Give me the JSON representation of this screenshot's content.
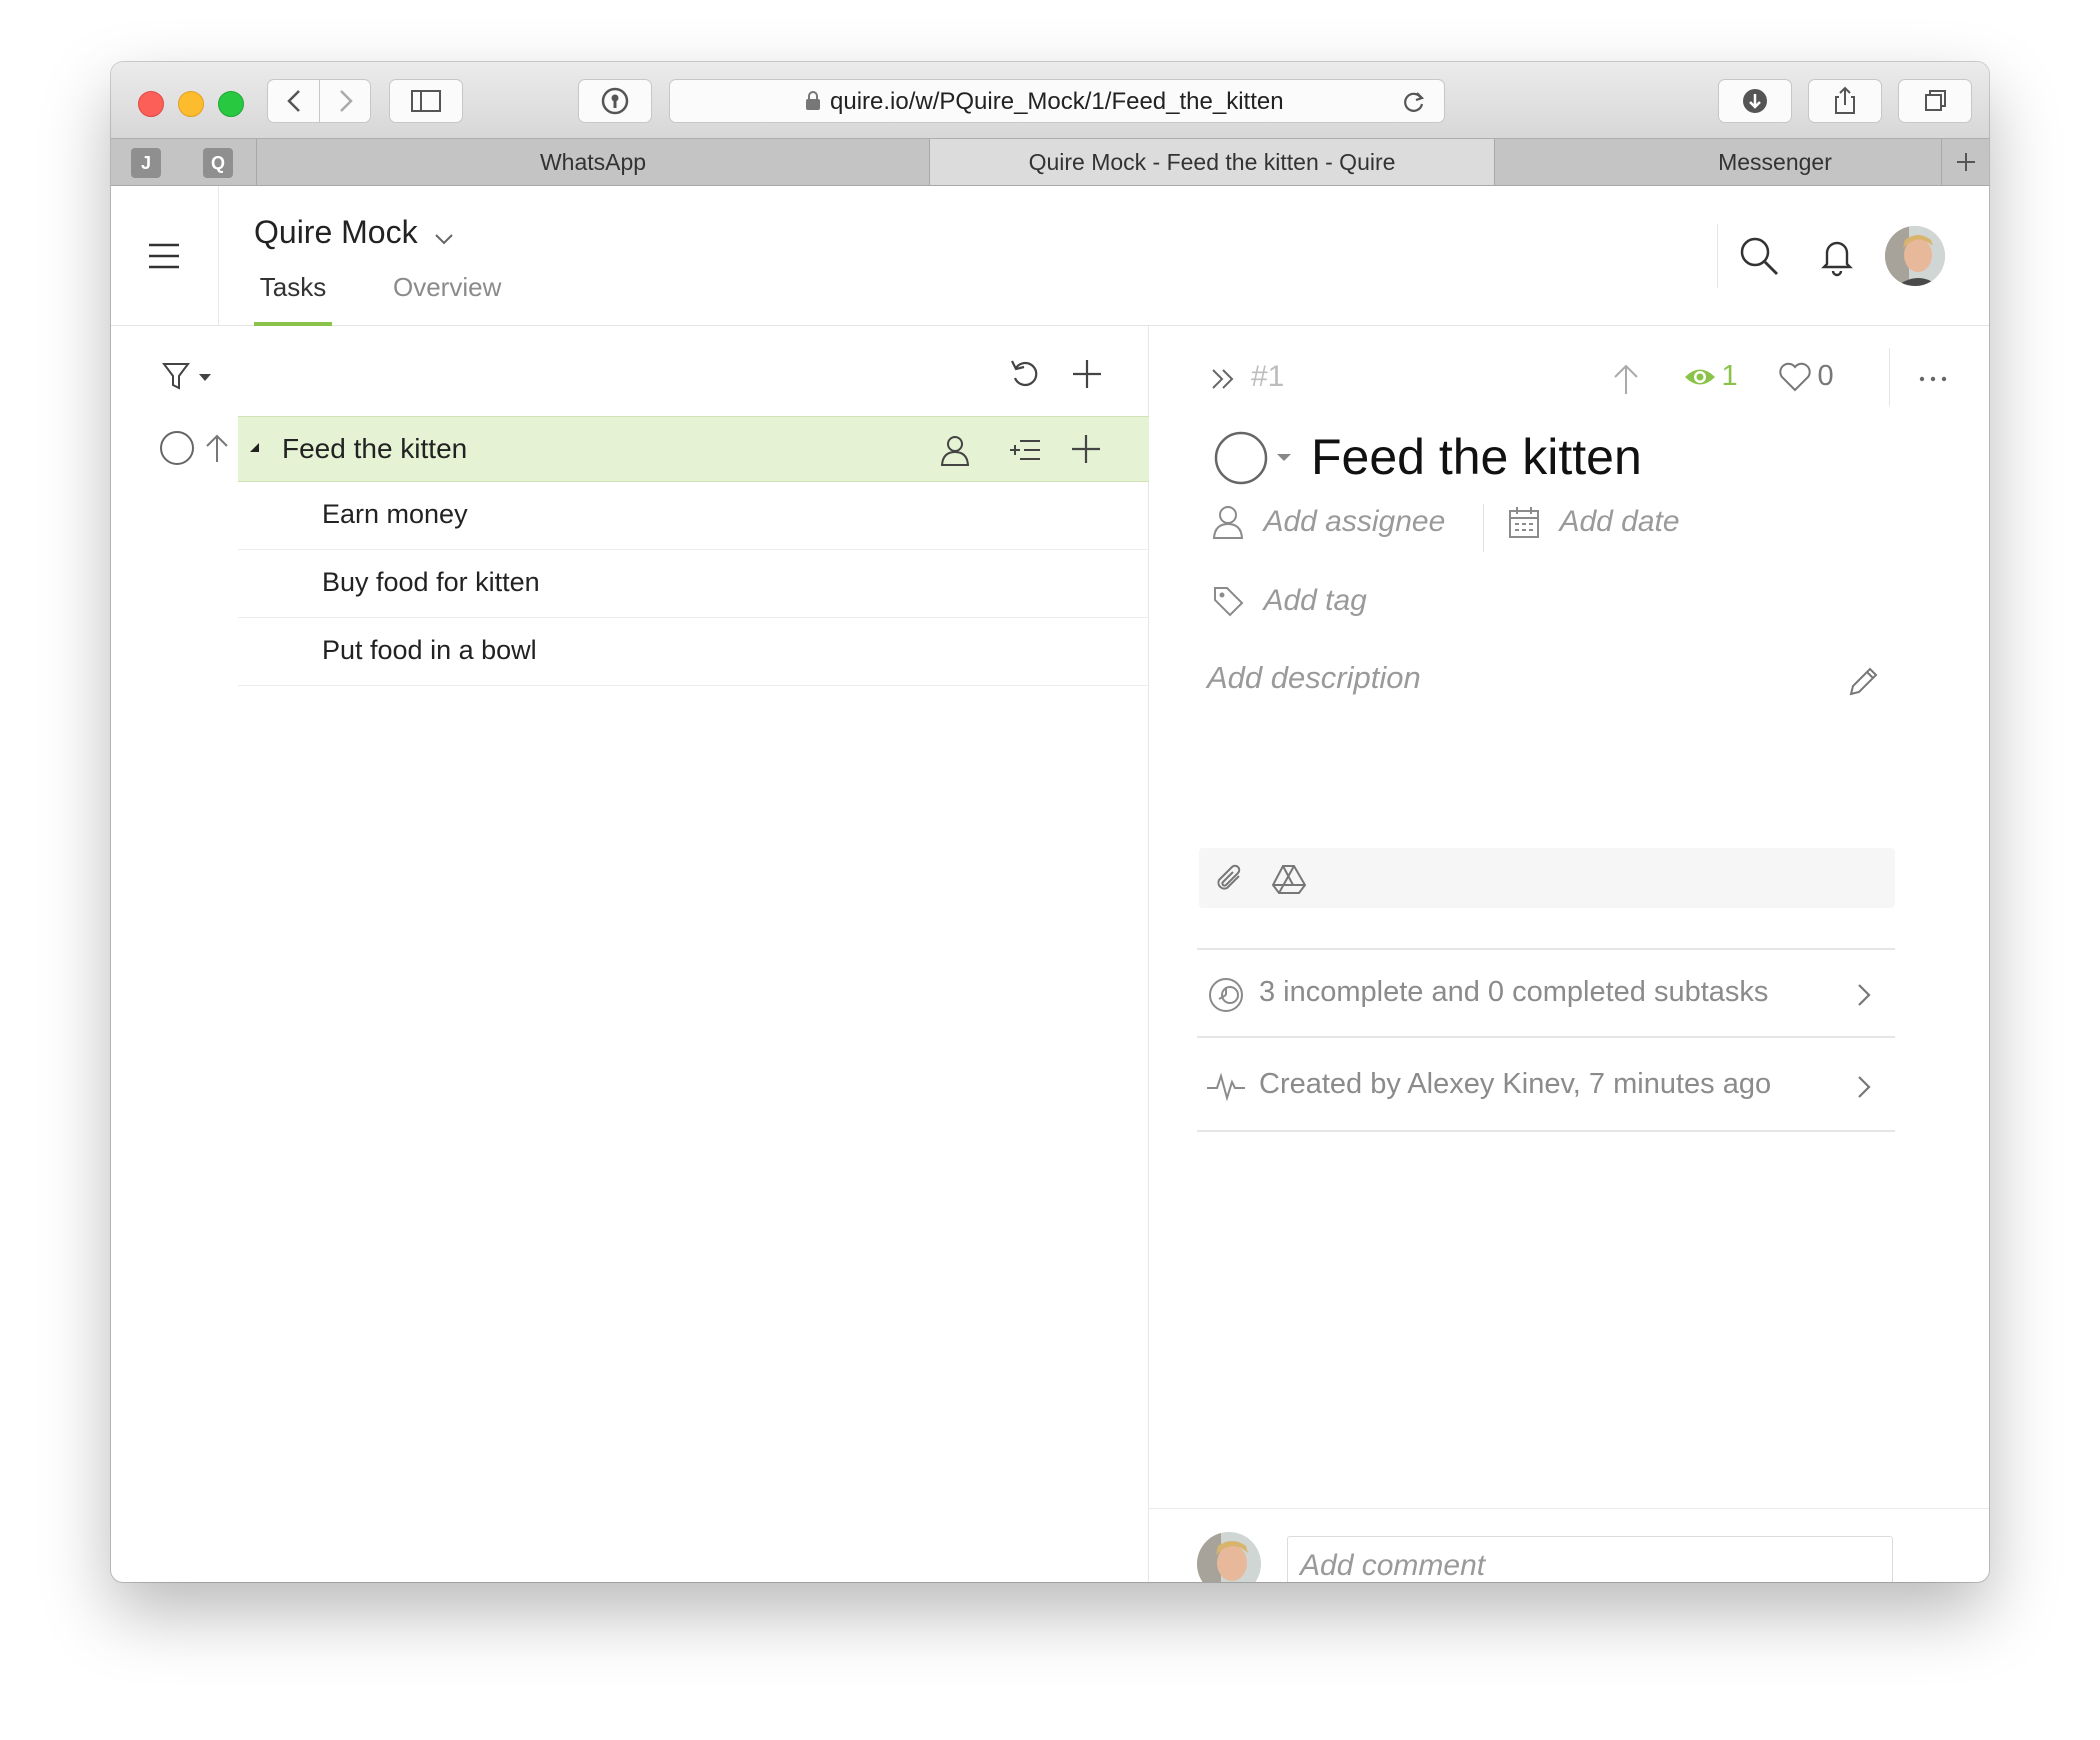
{
  "browser": {
    "url": "quire.io/w/PQuire_Mock/1/Feed_the_kitten",
    "pinned_tabs": [
      "J",
      "Q"
    ],
    "tabs": [
      {
        "label": "WhatsApp",
        "active": false
      },
      {
        "label": "Quire Mock - Feed the kitten - Quire",
        "active": true
      },
      {
        "label": "Messenger",
        "active": false
      }
    ]
  },
  "app": {
    "project_title": "Quire Mock",
    "nav_tabs": [
      {
        "label": "Tasks",
        "active": true
      },
      {
        "label": "Overview",
        "active": false
      }
    ],
    "accent_color": "#8bc34a"
  },
  "task_list": {
    "parent_task": {
      "title": "Feed the kitten"
    },
    "subtasks": [
      {
        "title": "Earn money"
      },
      {
        "title": "Buy food for kitten"
      },
      {
        "title": "Put food in a bowl"
      }
    ]
  },
  "detail": {
    "task_number": "#1",
    "watchers_count": "1",
    "likes_count": "0",
    "title": "Feed the kitten",
    "assignee_placeholder": "Add assignee",
    "date_placeholder": "Add date",
    "tag_placeholder": "Add tag",
    "description_placeholder": "Add description",
    "subtasks_summary": "3 incomplete and 0 completed subtasks",
    "activity_summary": "Created by Alexey Kinev, 7 minutes ago",
    "comment_placeholder": "Add comment"
  }
}
